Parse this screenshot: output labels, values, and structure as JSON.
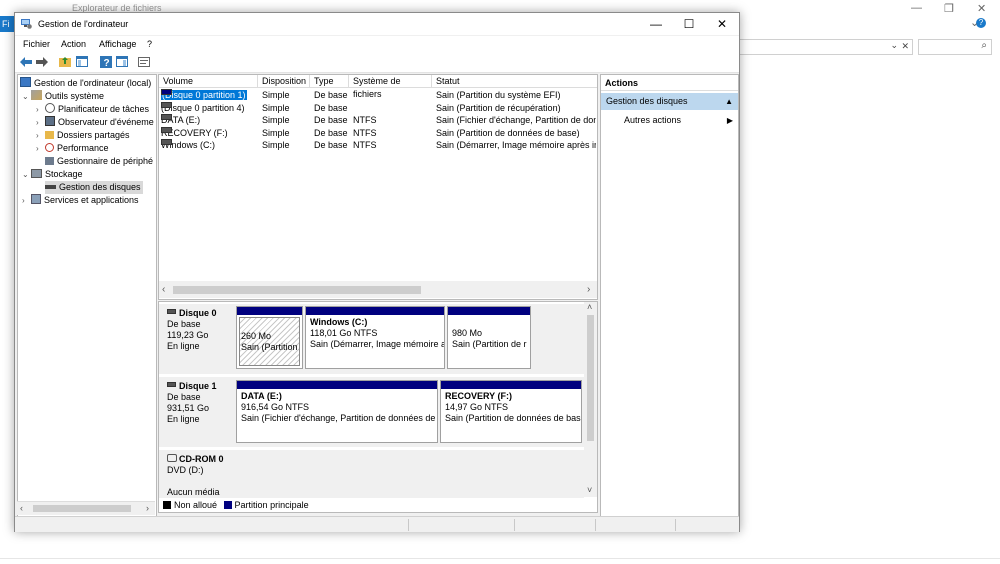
{
  "background": {
    "title": "Explorateur de fichiers",
    "ribbon_tab": "Fi",
    "min": "—",
    "restore": "❐",
    "close": "✕",
    "help": "?",
    "expand": "⌄",
    "dropdown": "⌄",
    "clear": "✕",
    "search": "⌕"
  },
  "window": {
    "title": "Gestion de l'ordinateur",
    "min": "—",
    "max": "☐",
    "close": "✕"
  },
  "menu": [
    "Fichier",
    "Action",
    "Affichage",
    "?"
  ],
  "tree": {
    "root": "Gestion de l'ordinateur (local)",
    "tools": "Outils système",
    "scheduler": "Planificateur de tâches",
    "eventviewer": "Observateur d'événeme",
    "shared": "Dossiers partagés",
    "performance": "Performance",
    "devmgr": "Gestionnaire de périphé",
    "storage": "Stockage",
    "diskmgmt": "Gestion des disques",
    "services": "Services et applications"
  },
  "columns": [
    "Volume",
    "Disposition",
    "Type",
    "Système de fichiers",
    "Statut"
  ],
  "volumes": [
    {
      "name": "(Disque 0 partition 1)",
      "layout": "Simple",
      "type": "De base",
      "fs": "",
      "status": "Sain (Partition du système EFI)"
    },
    {
      "name": "(Disque 0 partition 4)",
      "layout": "Simple",
      "type": "De base",
      "fs": "",
      "status": "Sain (Partition de récupération)"
    },
    {
      "name": "DATA (E:)",
      "layout": "Simple",
      "type": "De base",
      "fs": "NTFS",
      "status": "Sain (Fichier d'échange, Partition de donr"
    },
    {
      "name": "RECOVERY (F:)",
      "layout": "Simple",
      "type": "De base",
      "fs": "NTFS",
      "status": "Sain (Partition de données de base)"
    },
    {
      "name": "Windows (C:)",
      "layout": "Simple",
      "type": "De base",
      "fs": "NTFS",
      "status": "Sain (Démarrer, Image mémoire après inc"
    }
  ],
  "disks": {
    "disk0": {
      "name": "Disque 0",
      "type": "De base",
      "size": "119,23 Go",
      "state": "En ligne",
      "p1": {
        "size": "260 Mo",
        "status": "Sain (Partition"
      },
      "p2": {
        "name": "Windows  (C:)",
        "size": "118,01 Go NTFS",
        "status": "Sain (Démarrer, Image mémoire a"
      },
      "p3": {
        "size": "980 Mo",
        "status": "Sain (Partition de r"
      }
    },
    "disk1": {
      "name": "Disque 1",
      "type": "De base",
      "size": "931,51 Go",
      "state": "En ligne",
      "p1": {
        "name": "DATA  (E:)",
        "size": "916,54 Go NTFS",
        "status": "Sain (Fichier d'échange, Partition de données de b"
      },
      "p2": {
        "name": "RECOVERY  (F:)",
        "size": "14,97 Go NTFS",
        "status": "Sain (Partition de données de base"
      }
    },
    "cdrom": {
      "name": "CD-ROM 0",
      "type": "DVD (D:)",
      "media": "Aucun média"
    }
  },
  "legend": {
    "unallocated": "Non alloué",
    "primary": "Partition principale"
  },
  "actions": {
    "header": "Actions",
    "section": "Gestion des disques",
    "item": "Autres actions"
  },
  "colors": {
    "primary": "#00007f",
    "unallocated": "#000000",
    "selection": "#0078d7",
    "section": "#bcd7ee"
  }
}
